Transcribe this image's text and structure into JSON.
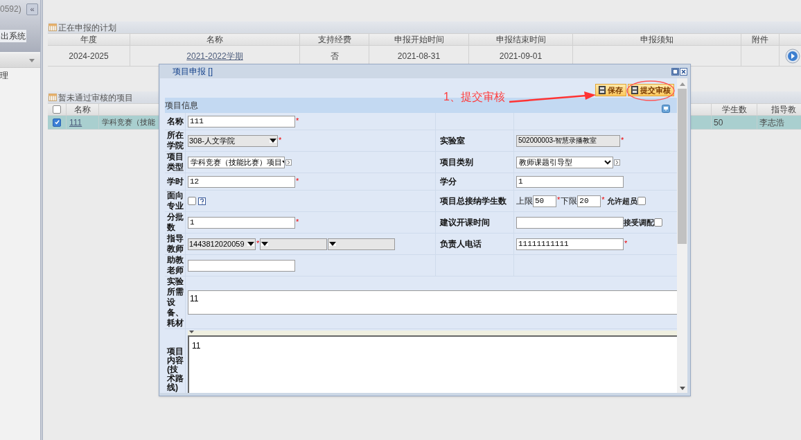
{
  "sidebar": {
    "user_text": "0592)",
    "collapse_button": "«",
    "logout_button": "出系统",
    "menu_items": [
      {
        "label": "理"
      }
    ]
  },
  "plan_panel": {
    "title": "正在申报的计划",
    "columns": [
      "年度",
      "名称",
      "支持经费",
      "申报开始时间",
      "申报结束时间",
      "申报须知",
      "附件"
    ],
    "rows": [
      {
        "year": "2024-2025",
        "name": "2021-2022学期",
        "funding": "否",
        "start": "2021-08-31",
        "end": "2021-09-01",
        "has_action": true
      }
    ]
  },
  "pending_panel": {
    "title": "暂未通过审核的项目",
    "header_checked": false,
    "columns": {
      "name": "名称",
      "students": "学生数",
      "teacher": "指导教"
    },
    "rows": [
      {
        "checked": true,
        "selected": true,
        "name": "111",
        "column_3": "学科竞赛（技能",
        "students": "50",
        "teacher": "李志浩"
      }
    ]
  },
  "dialog": {
    "title": "项目申报 []",
    "toolbar": [
      {
        "label": "保存"
      },
      {
        "label": "提交审核"
      }
    ],
    "section": "项目信息",
    "rows": [
      {
        "left": {
          "label": "名称",
          "kind": "text",
          "value": "111",
          "mark": "*"
        }
      },
      {
        "left": {
          "label": "所在学院",
          "kind": "combo",
          "value": "308-人文学院",
          "mark": "*"
        },
        "right": {
          "label": "实验室",
          "kind": "readonly",
          "value": "502000003-智慧录播教室",
          "mark": "*"
        }
      },
      {
        "left": {
          "label": "项目类型",
          "kind": "select",
          "value": "学科竞赛（技能比赛）项目",
          "picker": true
        },
        "right": {
          "label": "项目类别",
          "kind": "select",
          "value": "教师课题引导型",
          "picker": true
        }
      },
      {
        "left": {
          "label": "学时",
          "kind": "text",
          "value": "12",
          "mark": "*"
        },
        "right": {
          "label": "学分",
          "kind": "text",
          "value": "1"
        }
      },
      {
        "left": {
          "label": "面向专业",
          "kind": "checkbox_help",
          "checked": false
        },
        "right": {
          "label": "项目总接纳学生数",
          "kind": "limits",
          "limits": [
            {
              "prefix": "上限",
              "value": "50",
              "mark": "*"
            },
            {
              "prefix": "下限",
              "value": "20",
              "mark": "*"
            }
          ],
          "option": {
            "label": "允许超员",
            "checked": false
          }
        }
      },
      {
        "left": {
          "label": "分批数",
          "kind": "text",
          "value": "1",
          "mark": "*"
        },
        "right": {
          "label": "建议开课时间",
          "kind": "text_option",
          "option": {
            "label": "接受调配",
            "checked": false
          }
        }
      },
      {
        "left": {
          "label": "指导教师",
          "kind": "combos",
          "combos": [
            {
              "kind": "combo",
              "value": "1443812020059",
              "mark": "*"
            },
            {
              "kind": "combo"
            },
            {
              "kind": "combo"
            }
          ]
        },
        "right": {
          "label": "负责人电话",
          "kind": "text",
          "value": "11111111111",
          "mark": "*"
        }
      },
      {
        "left": {
          "label": "助教老师",
          "kind": "text"
        }
      },
      {
        "left": {
          "label": "实验所需设备、耗材",
          "kind": "textarea",
          "value": "11"
        }
      },
      {
        "left": {
          "label": "项目内容(技术路线)",
          "kind": "editor",
          "value": "11"
        }
      }
    ]
  },
  "annotation": {
    "text": "1、提交审核"
  }
}
